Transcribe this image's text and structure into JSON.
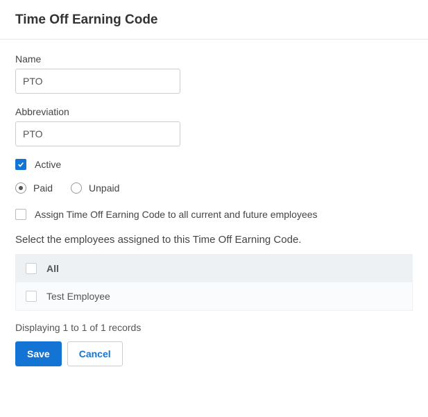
{
  "header": {
    "title": "Time Off Earning Code"
  },
  "form": {
    "name_label": "Name",
    "name_value": "PTO",
    "abbr_label": "Abbreviation",
    "abbr_value": "PTO",
    "active_label": "Active",
    "active_checked": true,
    "pay_type": {
      "paid_label": "Paid",
      "unpaid_label": "Unpaid",
      "selected": "paid"
    },
    "assign_all_label": "Assign Time Off Earning Code to all current and future employees",
    "assign_all_checked": false
  },
  "employees_section": {
    "subheading": "Select the employees assigned to this Time Off Earning Code.",
    "header_all_label": "All",
    "rows": [
      {
        "name": "Test Employee",
        "checked": false
      }
    ],
    "records_text": "Displaying 1 to 1 of 1 records"
  },
  "buttons": {
    "save": "Save",
    "cancel": "Cancel"
  }
}
